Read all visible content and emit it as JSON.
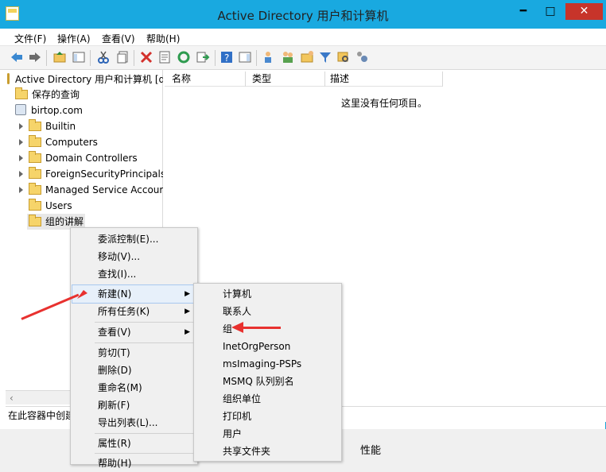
{
  "window": {
    "title": "Active Directory 用户和计算机"
  },
  "title_buttons": {
    "minimize": "━",
    "maximize": "□",
    "close": "✕"
  },
  "menubar": [
    "文件(F)",
    "操作(A)",
    "查看(V)",
    "帮助(H)"
  ],
  "tree": {
    "root": "Active Directory 用户和计算机 [d",
    "saved_queries": "保存的查询",
    "domain": "birtop.com",
    "items": [
      "Builtin",
      "Computers",
      "Domain Controllers",
      "ForeignSecurityPrincipals",
      "Managed Service Accour",
      "Users",
      "组的讲解"
    ]
  },
  "list": {
    "headers": [
      "名称",
      "类型",
      "描述"
    ],
    "empty_text": "这里没有任何项目。"
  },
  "status": {
    "text": "在此容器中创建"
  },
  "extra_text": "性能",
  "context_menu": [
    "委派控制(E)...",
    "移动(V)...",
    "查找(I)...",
    "新建(N)",
    "所有任务(K)",
    "查看(V)",
    "剪切(T)",
    "删除(D)",
    "重命名(M)",
    "刷新(F)",
    "导出列表(L)...",
    "属性(R)",
    "帮助(H)"
  ],
  "new_submenu": [
    "计算机",
    "联系人",
    "组",
    "InetOrgPerson",
    "msImaging-PSPs",
    "MSMQ 队列别名",
    "组织单位",
    "打印机",
    "用户",
    "共享文件夹"
  ],
  "colors": {
    "title_bar": "#19a9e0",
    "highlight": "#e7f0fa",
    "annotation": "#e8312f"
  }
}
